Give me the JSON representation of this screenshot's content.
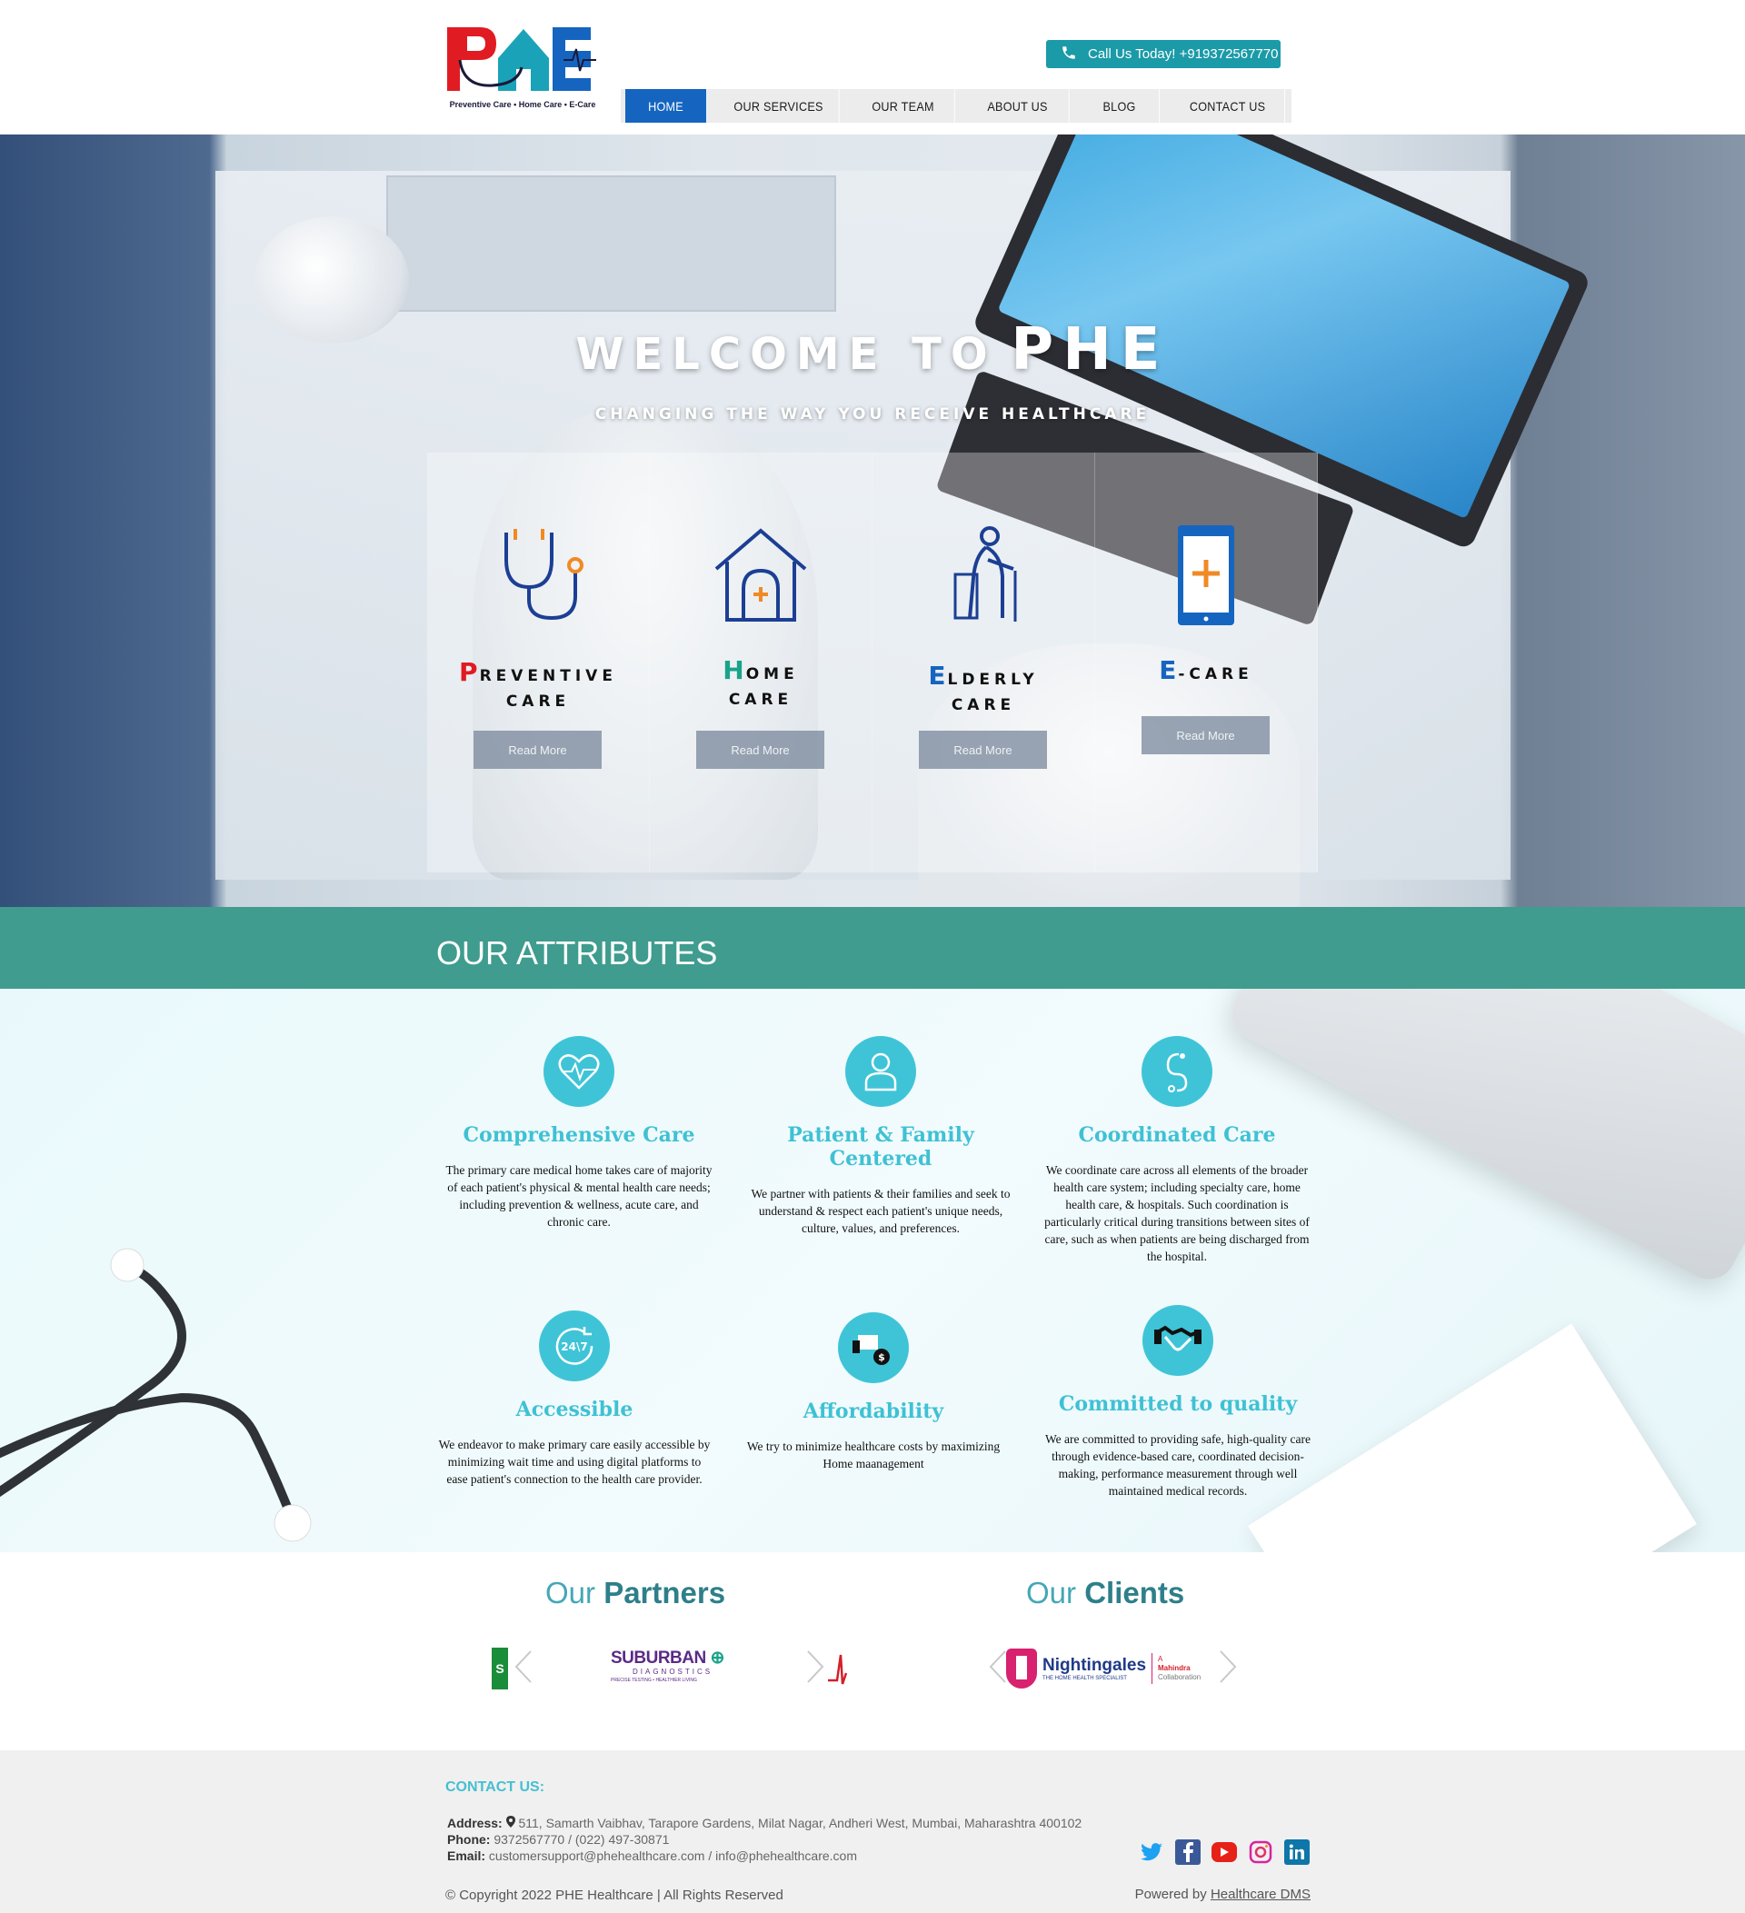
{
  "header": {
    "logo_tagline": "Preventive Care • Home Care • E-Care",
    "call_label": "Call Us Today! +919372567770"
  },
  "nav": [
    "HOME",
    "OUR SERVICES",
    "OUR TEAM",
    "ABOUT US",
    "BLOG",
    "CONTACT US"
  ],
  "hero": {
    "title_part1": "WELCOME TO",
    "title_part2": "PHE",
    "subtitle": "CHANGING THE WAY YOU RECEIVE HEALTHCARE"
  },
  "services": [
    {
      "initial": "P",
      "rest": "REVENTIVE",
      "line2": "CARE",
      "initial_color": "#e11b22",
      "button": "Read More",
      "icon": "stethoscope-icon"
    },
    {
      "initial": "H",
      "rest": "OME",
      "line2": "CARE",
      "initial_color": "#1aa38a",
      "button": "Read More",
      "icon": "home-care-icon"
    },
    {
      "initial": "E",
      "rest": "LDERLY",
      "line2": "CARE",
      "initial_color": "#1565c0",
      "button": "Read More",
      "icon": "elderly-icon"
    },
    {
      "initial": "E",
      "rest": "-CARE",
      "line2": "",
      "initial_color": "#1565c0",
      "button": "Read More",
      "icon": "mobile-care-icon"
    }
  ],
  "attributes": {
    "heading": "OUR ATTRIBUTES",
    "items": [
      {
        "title": "Comprehensive Care",
        "icon": "heart-pulse-icon",
        "text": "The primary care medical home takes care of majority of each patient's physical & mental health care needs; including prevention & wellness, acute care, and chronic care."
      },
      {
        "title": "Patient & Family Centered",
        "icon": "user-icon",
        "text": "We partner with patients & their families and seek to understand & respect each patient's unique needs, culture, values, and preferences."
      },
      {
        "title": "Coordinated Care",
        "icon": "stethoscope-icon",
        "text": "We coordinate care across all elements of the broader health care system; including specialty care, home health care, & hospitals. Such coordination is particularly critical during transitions between sites of care, such as when patients are being discharged from the hospital."
      },
      {
        "title": "Accessible",
        "icon": "clock-24-7-icon",
        "text": "We endeavor to make primary care easily accessible by minimizing wait time and using digital platforms to ease patient's connection to the health care provider."
      },
      {
        "title": "Affordability",
        "icon": "money-hand-icon",
        "text": "We try to minimize healthcare costs by maximizing Home maanagement"
      },
      {
        "title": "Committed to quality",
        "icon": "handshake-icon",
        "text": "We are committed to providing safe, high-quality care through evidence-based care, coordinated decision-making, performance measurement through well maintained medical records."
      }
    ]
  },
  "partners": {
    "heading_light": "Our",
    "heading_bold": "Partners",
    "logo_name": "SUBURBAN",
    "logo_sub": "DIAGNOSTICS",
    "logo_tag": "PRECISE TESTING • HEALTHIER LIVING",
    "left_partial": "S"
  },
  "clients": {
    "heading_light": "Our",
    "heading_bold": "Clients",
    "logo_name": "Nightingales",
    "logo_tag": "THE HOME HEALTH SPECIALIST",
    "collab_brand": "Mahindra",
    "collab_prefix": "A",
    "collab_suffix": "Collaboration"
  },
  "footer": {
    "contact_heading": "CONTACT US:",
    "address_label": "Address:",
    "address": "511, Samarth Vaibhav, Tarapore Gardens, Milat Nagar, Andheri West, Mumbai, Maharashtra 400102",
    "phone_label": "Phone:",
    "phone": "9372567770 / (022) 497-30871",
    "email_label": "Email:",
    "email": "customersupport@phehealthcare.com / info@phehealthcare.com",
    "copyright": "© Copyright 2022 PHE Healthcare | All Rights Reserved",
    "powered_prefix": "Powered by",
    "powered_link": "Healthcare DMS",
    "socials": [
      "twitter-icon",
      "facebook-icon",
      "youtube-icon",
      "instagram-icon",
      "linkedin-icon"
    ]
  },
  "colors": {
    "brand_blue": "#1565c0",
    "brand_red": "#e11b22",
    "teal": "#3f9c8e",
    "call_teal": "#1b9aa8",
    "attr_cyan": "#3fc4d7"
  }
}
